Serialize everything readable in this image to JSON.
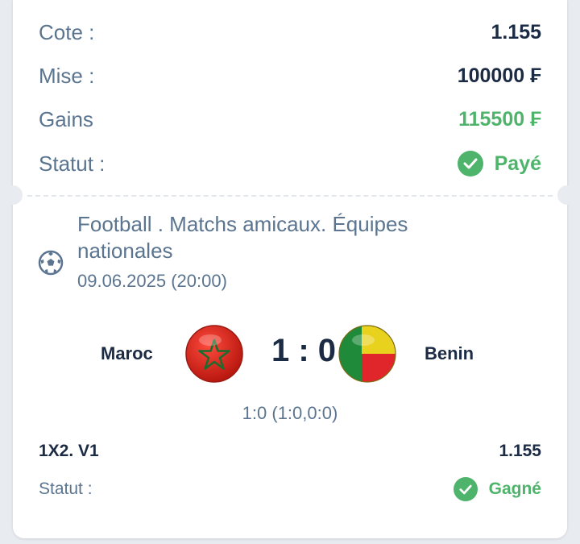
{
  "summary": {
    "cote_label": "Cote :",
    "cote_value": "1.155",
    "mise_label": "Mise :",
    "mise_value": "100000 ₣",
    "gains_label": "Gains",
    "gains_value": "115500 ₣",
    "statut_label": "Statut :",
    "statut_value": "Payé"
  },
  "event": {
    "icon": "soccer-ball-icon",
    "title": "Football . Matchs amicaux. Équipes nationales",
    "date": "09.06.2025 (20:00)",
    "home_team": "Maroc",
    "away_team": "Benin",
    "score": "1 : 0",
    "score_detail": "1:0 (1:0,0:0)"
  },
  "selection": {
    "market": "1X2. V1",
    "odd": "1.155",
    "statut_label": "Statut :",
    "statut_value": "Gagné"
  },
  "colors": {
    "label": "#5b7590",
    "value": "#1c2b44",
    "success": "#4fb46b",
    "background": "#e8ecf1"
  }
}
